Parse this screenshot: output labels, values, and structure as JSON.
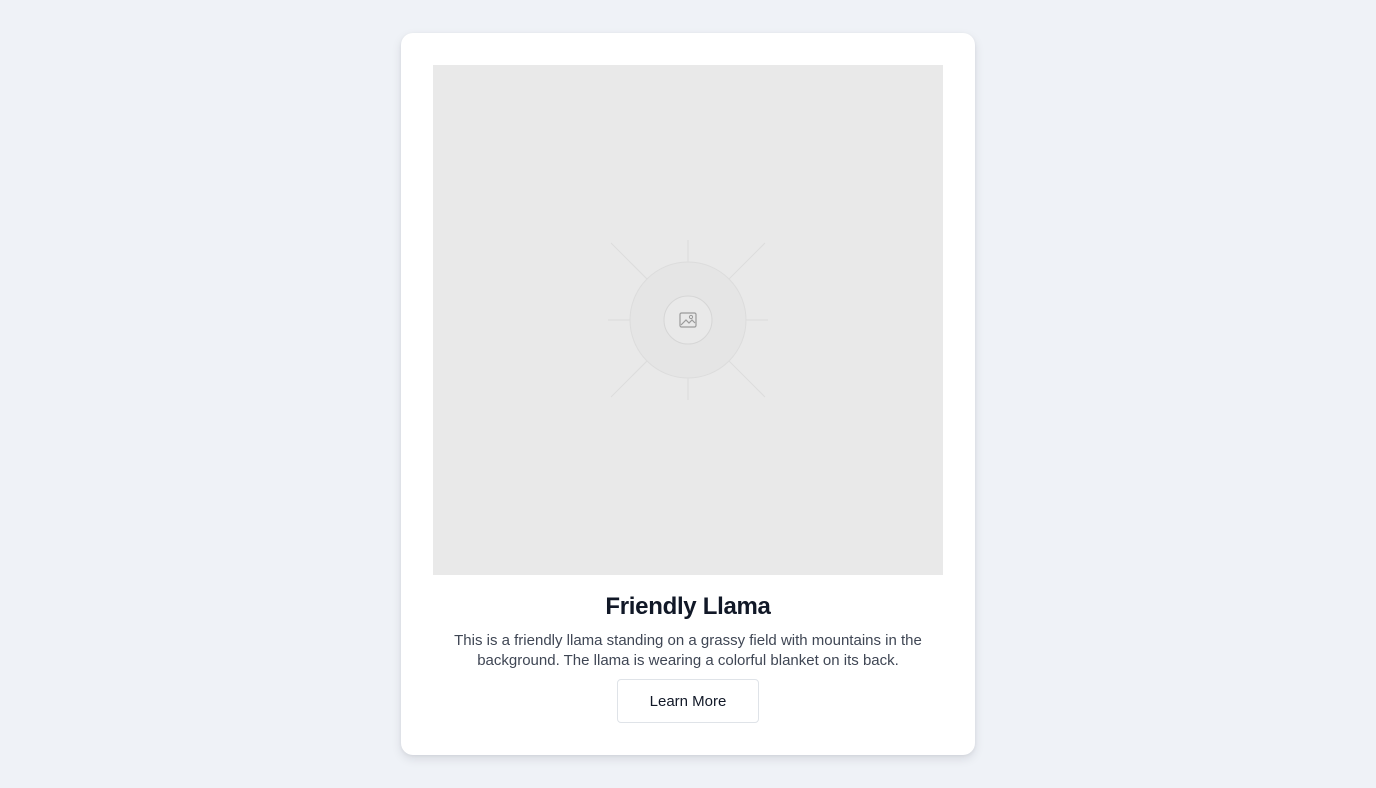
{
  "card": {
    "image": {
      "icon": "image-icon"
    },
    "title": "Friendly Llama",
    "description": "This is a friendly llama standing on a grassy field with mountains in the background. The llama is wearing a colorful blanket on its back.",
    "button_label": "Learn More"
  }
}
